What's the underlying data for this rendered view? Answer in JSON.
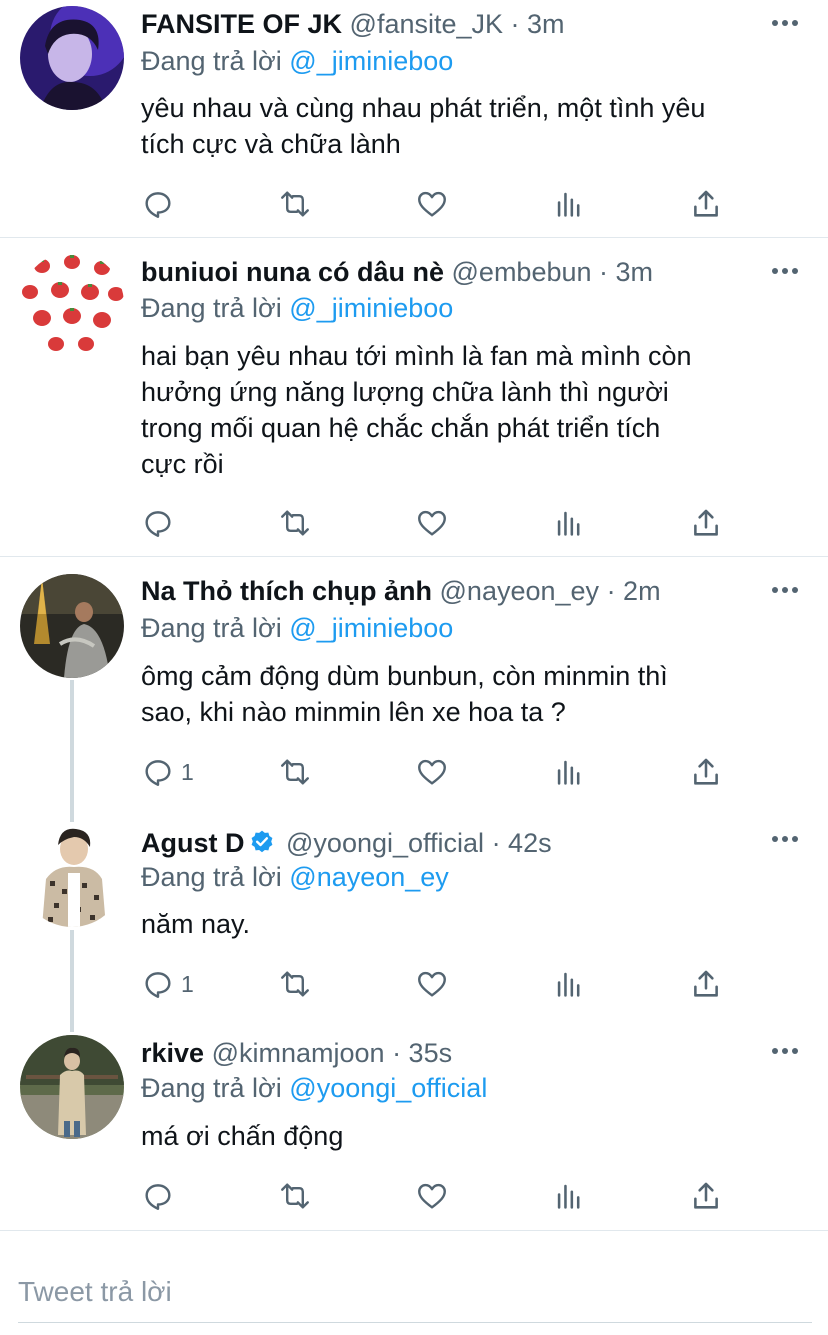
{
  "tweets": [
    {
      "name": "FANSITE OF JK",
      "handle": "@fansite_JK",
      "time": "· 3m",
      "replying_label": "Đang trả lời",
      "replying_to": "@_jiminieboo",
      "lines": [
        "yêu nhau và cùng nhau phát triển, một tình yêu",
        "tích cực và chữa lành"
      ],
      "reply_count": "",
      "verified": false
    },
    {
      "name": "buniuoi nuna có dâu nè",
      "handle": "@embebun",
      "time": "· 3m",
      "replying_label": "Đang trả lời",
      "replying_to": "@_jiminieboo",
      "lines": [
        "hai bạn yêu nhau tới mình là fan mà mình còn",
        "hưởng ứng năng lượng chữa lành thì người",
        "trong mối quan hệ chắc chắn phát triển tích",
        "cực rồi"
      ],
      "reply_count": "",
      "verified": false
    },
    {
      "name": "Na Thỏ thích chụp ảnh",
      "handle": "@nayeon_ey",
      "time": "· 2m",
      "replying_label": "Đang trả lời",
      "replying_to": "@_jiminieboo",
      "lines": [
        "ômg cảm động dùm bunbun, còn minmin thì",
        "sao, khi nào minmin lên xe hoa ta ?"
      ],
      "reply_count": "1",
      "verified": false
    },
    {
      "name": "Agust D",
      "handle": "@yoongi_official",
      "time": "· 42s",
      "replying_label": "Đang trả lời",
      "replying_to": "@nayeon_ey",
      "lines": [
        "năm nay."
      ],
      "reply_count": "1",
      "verified": true
    },
    {
      "name": "rkive",
      "handle": "@kimnamjoon",
      "time": "· 35s",
      "replying_label": "Đang trả lời",
      "replying_to": "@yoongi_official",
      "lines": [
        "má ơi chấn động"
      ],
      "reply_count": "",
      "verified": false
    }
  ],
  "compose": {
    "placeholder": "Tweet trả lời"
  },
  "icons": {
    "reply": "reply-icon",
    "retweet": "retweet-icon",
    "like": "heart-icon",
    "views": "analytics-icon",
    "share": "share-icon",
    "more": "more-icon",
    "verified": "verified-badge-icon"
  },
  "colors": {
    "accent": "#1d9bf0",
    "secondary_text": "#536471",
    "divider": "#e1e8ed"
  }
}
